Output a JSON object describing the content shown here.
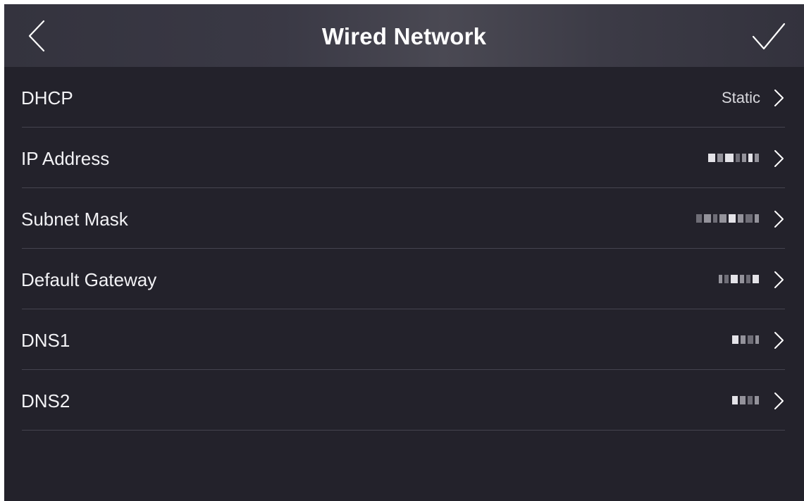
{
  "header": {
    "title": "Wired Network",
    "back_icon": "back-chevron-icon",
    "confirm_icon": "checkmark-icon"
  },
  "rows": [
    {
      "label": "DHCP",
      "value": "Static"
    },
    {
      "label": "IP Address",
      "value": ""
    },
    {
      "label": "Subnet Mask",
      "value": ""
    },
    {
      "label": "Default Gateway",
      "value": ""
    },
    {
      "label": "DNS1",
      "value": ""
    },
    {
      "label": "DNS2",
      "value": ""
    }
  ],
  "colors": {
    "background": "#23222b",
    "header": "#3a3945",
    "text": "#f2f2f5",
    "divider": "#45444f"
  }
}
